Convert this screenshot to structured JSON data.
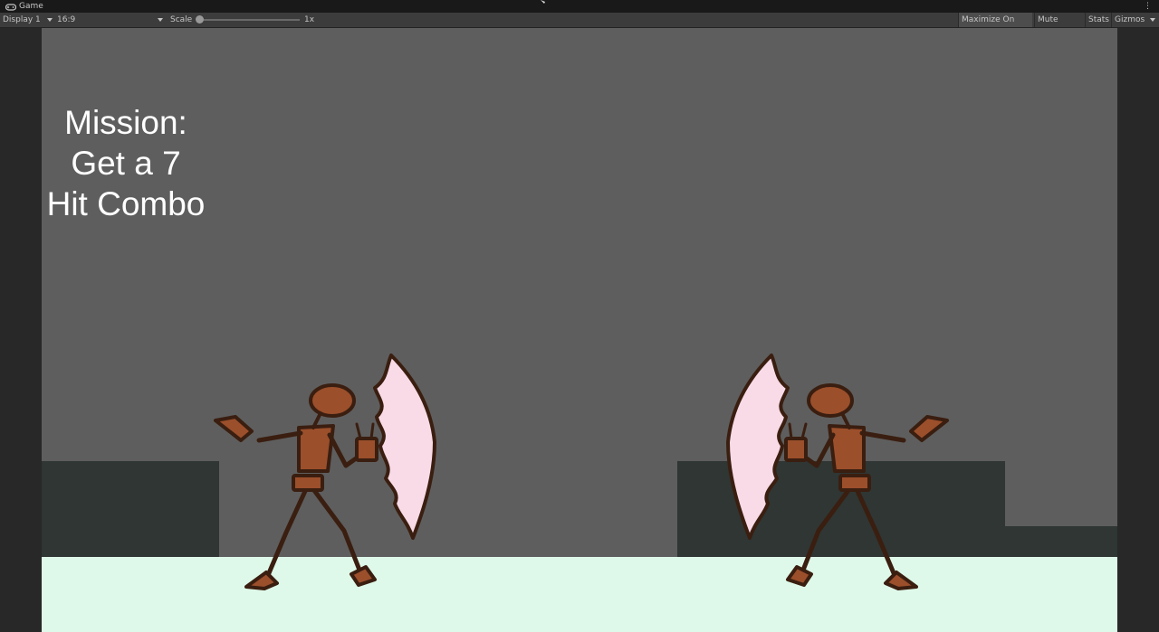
{
  "window": {
    "tab_title": "Game",
    "icon": "gamepad-icon",
    "menu_icon": "kebab-icon"
  },
  "toolbar": {
    "display": "Display 1",
    "aspect": "16:9",
    "scale_label": "Scale",
    "scale_value": "1x",
    "maximize_on_play": "Maximize On Play",
    "mute_audio": "Mute Audio",
    "stats": "Stats",
    "gizmos": "Gizmos"
  },
  "game": {
    "mission_line1": "Mission:",
    "mission_line2": "Get a 7",
    "mission_line3": "Hit Combo",
    "colors": {
      "sky": "#5e5e5e",
      "platform": "#2f3633",
      "floor": "#def9e9",
      "fighter_body": "#9b4f2b",
      "fighter_outline": "#3a1e10",
      "slash": "#f9dbe8"
    },
    "fighters": [
      "player-fighter",
      "enemy-fighter"
    ]
  }
}
